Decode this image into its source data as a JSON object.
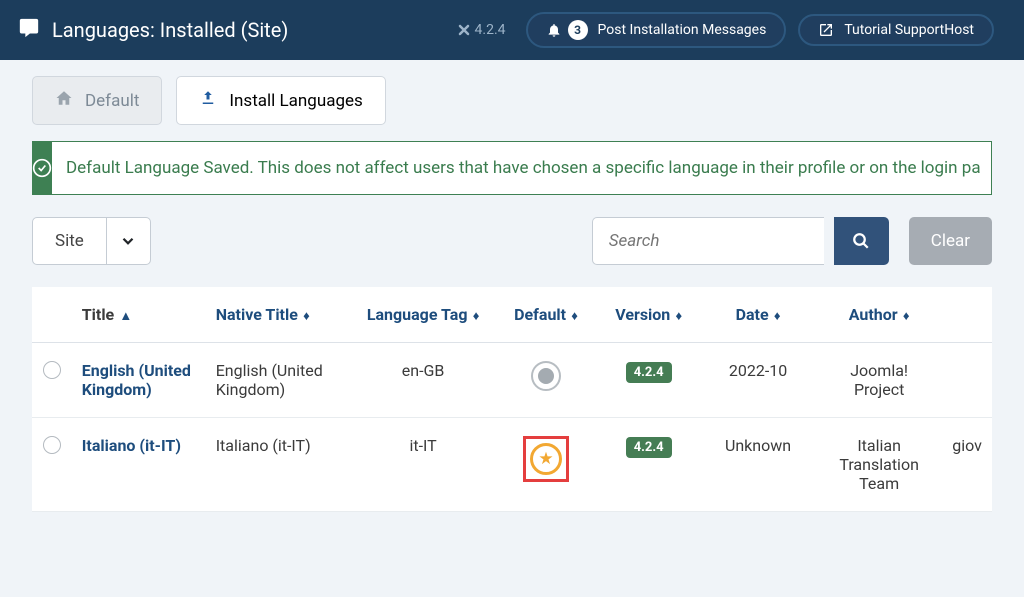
{
  "header": {
    "page_title": "Languages: Installed (Site)",
    "joomla_version": "4.2.4",
    "post_install_count": "3",
    "post_install_label": "Post Installation Messages",
    "tutorial_label": "Tutorial SupportHost"
  },
  "toolbar": {
    "default_label": "Default",
    "install_label": "Install Languages"
  },
  "alert": {
    "message": "Default Language Saved. This does not affect users that have chosen a specific language in their profile or on the login pa"
  },
  "filters": {
    "select_value": "Site",
    "search_placeholder": "Search",
    "clear_label": "Clear"
  },
  "table": {
    "headers": {
      "title": "Title",
      "native_title": "Native Title",
      "language_tag": "Language Tag",
      "default": "Default",
      "version": "Version",
      "date": "Date",
      "author": "Author"
    },
    "rows": [
      {
        "title": "English (United Kingdom)",
        "native": "English (United Kingdom)",
        "tag": "en-GB",
        "is_default": true,
        "version": "4.2.4",
        "date": "2022-10",
        "author": "Joomla! Project",
        "extra": ""
      },
      {
        "title": "Italiano (it-IT)",
        "native": "Italiano (it-IT)",
        "tag": "it-IT",
        "is_default": false,
        "is_highlighted": true,
        "version": "4.2.4",
        "date": "Unknown",
        "author": "Italian Translation Team",
        "extra": "giov"
      }
    ]
  }
}
